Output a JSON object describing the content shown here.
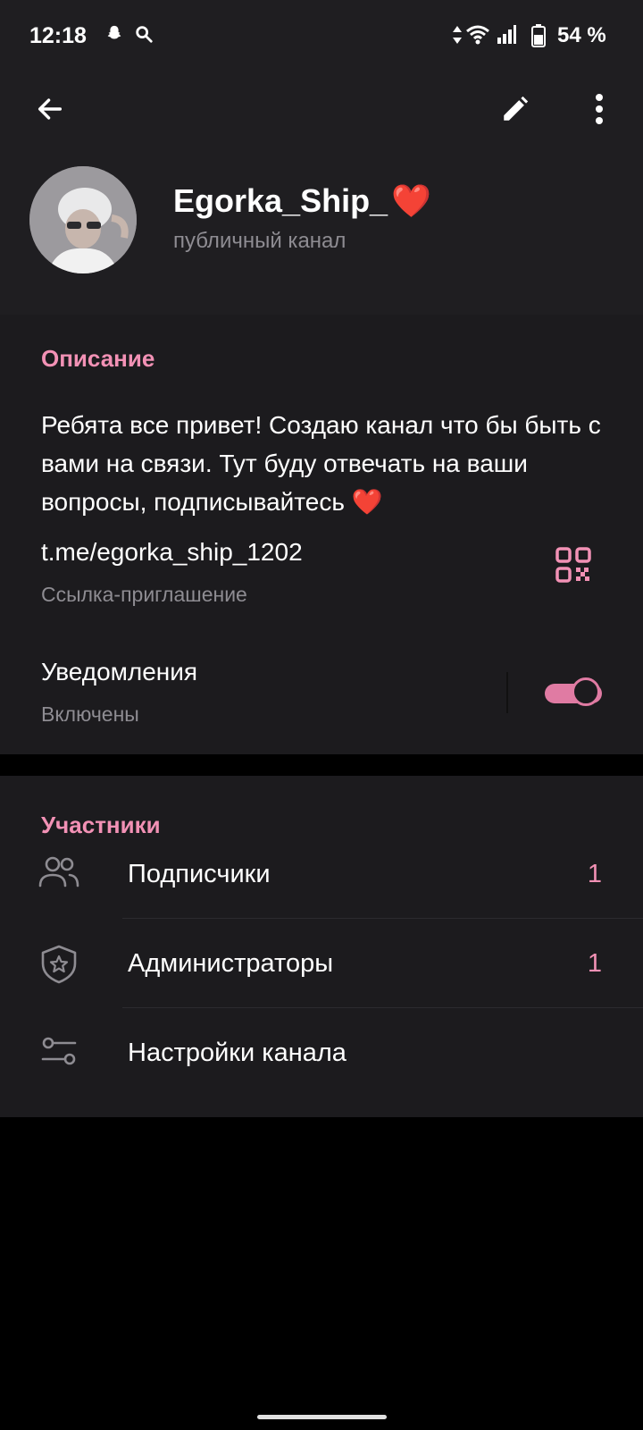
{
  "status_bar": {
    "time": "12:18",
    "battery": "54 %",
    "icons": [
      "snapchat-icon",
      "search-icon",
      "data-arrows-icon",
      "wifi-icon",
      "signal-icon",
      "battery-icon"
    ]
  },
  "toolbar": {
    "back_icon": "arrow-left-icon",
    "edit_icon": "pencil-icon",
    "more_icon": "more-vert-icon"
  },
  "channel": {
    "name": "Egorka_Ship_",
    "name_emoji": "❤️",
    "subtitle": "публичный канал"
  },
  "info": {
    "title": "Описание",
    "description": "Ребята все привет! Создаю канал что бы быть с вами на связи. Тут буду отвечать на ваши вопросы, подписывайтесь ❤️",
    "link": "t.me/egorka_ship_1202",
    "link_label": "Ссылка-приглашение",
    "notifications_label": "Уведомления",
    "notifications_state": "Включены",
    "notifications_on": true
  },
  "members": {
    "title": "Участники",
    "rows": [
      {
        "label": "Подписчики",
        "count": "1",
        "icon": "people-icon"
      },
      {
        "label": "Администраторы",
        "count": "1",
        "icon": "shield-star-icon"
      },
      {
        "label": "Настройки канала",
        "count": "",
        "icon": "sliders-icon"
      }
    ]
  },
  "colors": {
    "accent": "#f291b5",
    "background": "#000000",
    "surface": "#1c1b1e",
    "header": "#1f1e21",
    "muted_text": "#8e8c92"
  }
}
